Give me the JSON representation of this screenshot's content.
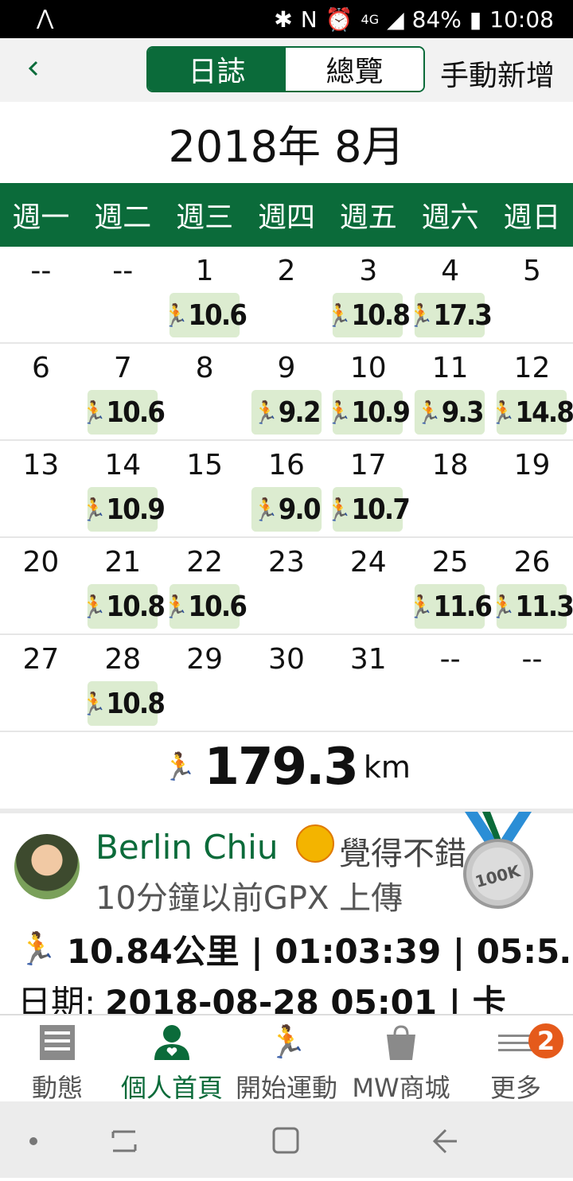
{
  "status_bar": {
    "battery": "84%",
    "time": "10:08",
    "network": "4G"
  },
  "header": {
    "tab_log": "日誌",
    "tab_overview": "總覽",
    "manual_add": "手動新增"
  },
  "calendar": {
    "month_title": "2018年 8月",
    "weekdays": [
      "週一",
      "週二",
      "週三",
      "週四",
      "週五",
      "週六",
      "週日"
    ],
    "weeks": [
      [
        {
          "day": "--"
        },
        {
          "day": "--"
        },
        {
          "day": "1",
          "km": "10.6"
        },
        {
          "day": "2"
        },
        {
          "day": "3",
          "km": "10.8"
        },
        {
          "day": "4",
          "km": "17.3"
        },
        {
          "day": "5"
        }
      ],
      [
        {
          "day": "6"
        },
        {
          "day": "7",
          "km": "10.6"
        },
        {
          "day": "8"
        },
        {
          "day": "9",
          "km": "9.2"
        },
        {
          "day": "10",
          "km": "10.9"
        },
        {
          "day": "11",
          "km": "9.3"
        },
        {
          "day": "12",
          "km": "14.8"
        }
      ],
      [
        {
          "day": "13"
        },
        {
          "day": "14",
          "km": "10.9"
        },
        {
          "day": "15"
        },
        {
          "day": "16",
          "km": "9.0"
        },
        {
          "day": "17",
          "km": "10.7"
        },
        {
          "day": "18"
        },
        {
          "day": "19"
        }
      ],
      [
        {
          "day": "20"
        },
        {
          "day": "21",
          "km": "10.8"
        },
        {
          "day": "22",
          "km": "10.6"
        },
        {
          "day": "23"
        },
        {
          "day": "24"
        },
        {
          "day": "25",
          "km": "11.6"
        },
        {
          "day": "26",
          "km": "11.3"
        }
      ],
      [
        {
          "day": "27"
        },
        {
          "day": "28",
          "km": "10.8"
        },
        {
          "day": "29"
        },
        {
          "day": "30"
        },
        {
          "day": "31"
        },
        {
          "day": "--"
        },
        {
          "day": "--"
        }
      ]
    ],
    "total_value": "179.3",
    "total_unit": "km"
  },
  "activity": {
    "user": "Berlin Chiu",
    "mood": "覺得不錯",
    "upload_info": "10分鐘以前GPX 上傳",
    "stats": "10.84公里 | 01:03:39 | 05:5…",
    "date_label": "日期:",
    "date_value": "2018-08-28 05:01 | 卡",
    "medal_text": "100K"
  },
  "bottom_nav": [
    {
      "label": "動態",
      "icon": "feed-icon"
    },
    {
      "label": "個人首頁",
      "icon": "profile-icon"
    },
    {
      "label": "開始運動",
      "icon": "run-icon"
    },
    {
      "label": "MW商城",
      "icon": "shop-bag-icon"
    },
    {
      "label": "更多",
      "icon": "menu-icon"
    }
  ],
  "more_badge": "2",
  "colors": {
    "brand_green": "#0b6b3a",
    "badge_bg": "#dcecd0",
    "notify_orange": "#e55a1b"
  }
}
